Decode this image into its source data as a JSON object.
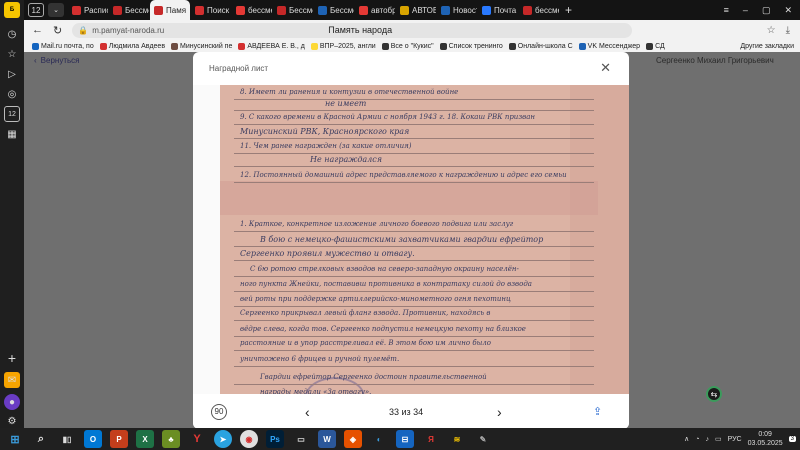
{
  "tabs": [
    {
      "label": "Распис",
      "color": "#d32f2f"
    },
    {
      "label": "Бессме",
      "color": "#c62828"
    },
    {
      "label": "Памя",
      "color": "#c62828",
      "active": true
    },
    {
      "label": "Поиск н",
      "color": "#d32f2f"
    },
    {
      "label": "бессме",
      "color": "#e53935"
    },
    {
      "label": "Бессме",
      "color": "#c62828"
    },
    {
      "label": "Бессме",
      "color": "#1e63b5"
    },
    {
      "label": "автобр",
      "color": "#e53935"
    },
    {
      "label": "АВТОБ",
      "color": "#d8a400"
    },
    {
      "label": "Новост",
      "color": "#1e63b5"
    },
    {
      "label": "Почта",
      "color": "#2979ff"
    },
    {
      "label": "бессме",
      "color": "#c62828"
    }
  ],
  "tab_counter": "12",
  "address": {
    "url": "m.pamyat-naroda.ru",
    "title": "Память народа"
  },
  "bookmarks": [
    {
      "label": "Mail.ru почта, по",
      "color": "#1565c0"
    },
    {
      "label": "Людмила Авдеев",
      "color": "#d32f2f"
    },
    {
      "label": "Минусинский пе",
      "color": "#6d4c41"
    },
    {
      "label": "АВДЕЕВА Е. В., д",
      "color": "#d32f2f"
    },
    {
      "label": "ВПР–2025, англи",
      "color": "#fdd835"
    },
    {
      "label": "Все о \"Кукис\"",
      "color": "#333333"
    },
    {
      "label": "Список тренинго",
      "color": "#333333"
    },
    {
      "label": "Онлайн-школа С",
      "color": "#333333"
    },
    {
      "label": "VK Мессенджер",
      "color": "#1e63b5"
    },
    {
      "label": "СД",
      "color": "#333333"
    }
  ],
  "other_bookmarks": "Другие закладки",
  "page": {
    "back_label": "Вернуться",
    "person_name": "Сергеенко Михаил Григорьевич"
  },
  "modal": {
    "title": "Наградной лист",
    "counter": "33 из 34",
    "rotate_label": "90"
  },
  "document_lines": [
    "8. Имеет ли ранения и контузии в отечественной войне",
    "не имеет",
    "9. С какого времени в Красной Армии с ноября 1943 г.    18. Кокаш РВК призван",
    "Минусинский РВК, Красноярского края",
    "11. Чем ранее награжден (за какие отличия)",
    "Не награждался",
    "12. Постоянный домашний адрес представляемого к награждению и адрес его семьи",
    "1. Краткое, конкретное изложение личного боевого подвига или заслуг",
    "В бою с немецко-фашистскими захватчиками гвардии ефрейтор",
    "Сергеенко проявил мужество и отвагу.",
    "С 6ю ротою стрелковых взводов на северо-западную окраину населён-",
    "ного пункта Жнейки, поставивш противника в контратаку силой до взвода",
    "вей роты при поддержке артиллерийско-минометного огня пехотинц",
    "Сергеенко прикрывал левый фланг взвода. Противник, находясь в",
    "вёдре слева, когда тов. Сергеенко подпустил немецкую пехоту на близкое",
    "расстояние и в упор расстреливал её. В этом бою им лично было",
    "уничтожено 6 фрицев и ручной пулемёт.",
    "Гвардии ефрейтор Сергеенко достоин правительственной",
    "награды медали «За отвагу»."
  ],
  "tray": {
    "lang": "РУС",
    "time": "0:09",
    "date": "03.05.2025",
    "notif": "3"
  }
}
